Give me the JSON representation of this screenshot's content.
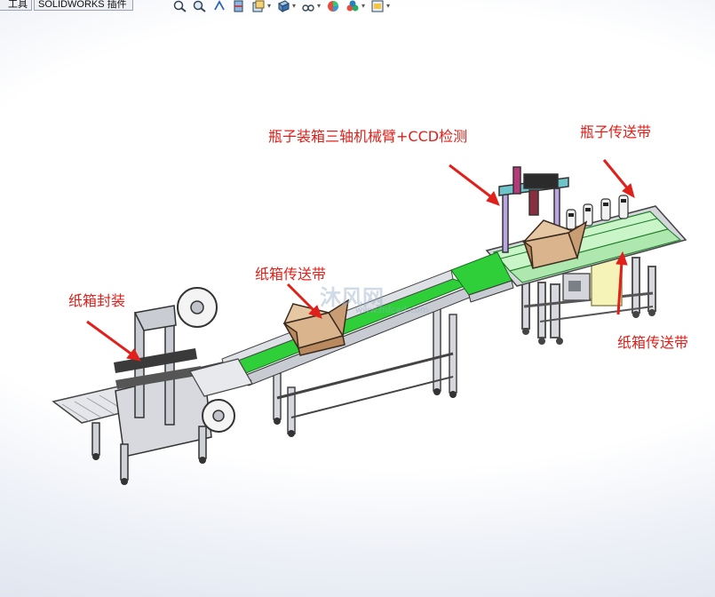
{
  "toolbar": {
    "tab_tools": "工具",
    "tab_addins": "SOLIDWORKS 插件",
    "icons": [
      "zoom-to-fit-icon",
      "zoom-area-icon",
      "previous-view-icon",
      "section-view-icon",
      "view-orientation-icon",
      "display-style-icon",
      "hide-show-items-icon",
      "edit-appearance-icon",
      "apply-scene-icon",
      "view-settings-icon"
    ]
  },
  "labels": {
    "bottle_arm": "瓶子装箱三轴机械臂+CCD检测",
    "bottle_conveyor": "瓶子传送带",
    "carton_conveyor_mid": "纸箱传送带",
    "carton_conveyor_right": "纸箱传送带",
    "carton_sealing": "纸箱封装"
  },
  "watermark": {
    "text": "沐风网",
    "sub": "www.mfcad.com"
  },
  "colors": {
    "annotation_red": "#e0201a",
    "belt_green": "#2fcf3a",
    "frame_gray": "#c9ccd2",
    "cardboard_brown": "#c79a6e"
  }
}
